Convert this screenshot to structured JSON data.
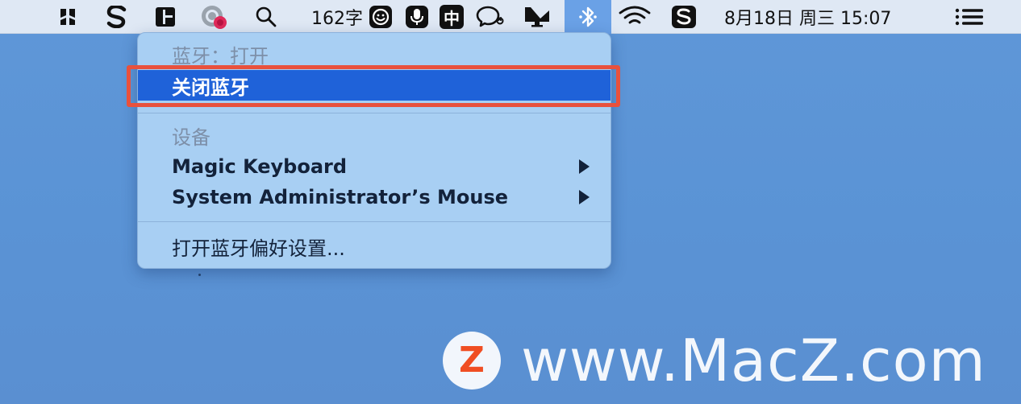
{
  "menubar": {
    "word_count": "162字",
    "input_method": "中",
    "datetime": "8月18日 周三  15:07",
    "icons": [
      "kuaijianfang-icon",
      "sogou-s-icon",
      "grid-app-icon",
      "record-icon",
      "search-icon",
      "emoji-icon",
      "microphone-icon",
      "chinese-input-icon",
      "chat-bubble-icon",
      "display-icon",
      "bluetooth-icon",
      "wifi-icon",
      "sogou-input-icon",
      "control-center-icon"
    ]
  },
  "bluetooth_menu": {
    "status_header": "蓝牙：打开",
    "toggle_action": "关闭蓝牙",
    "devices_header": "设备",
    "devices": [
      {
        "name": "Magic Keyboard"
      },
      {
        "name": "System Administrator’s Mouse"
      }
    ],
    "preferences_action": "打开蓝牙偏好设置..."
  },
  "watermark": {
    "logo_letter": "Z",
    "text": "www.MacZ.com"
  },
  "colors": {
    "highlight": "#1f62d9",
    "annotation_box": "#e8513d",
    "menu_bg": "#a8cff3",
    "desktop": "#5a93d5",
    "watermark_logo_accent": "#f04e23"
  }
}
